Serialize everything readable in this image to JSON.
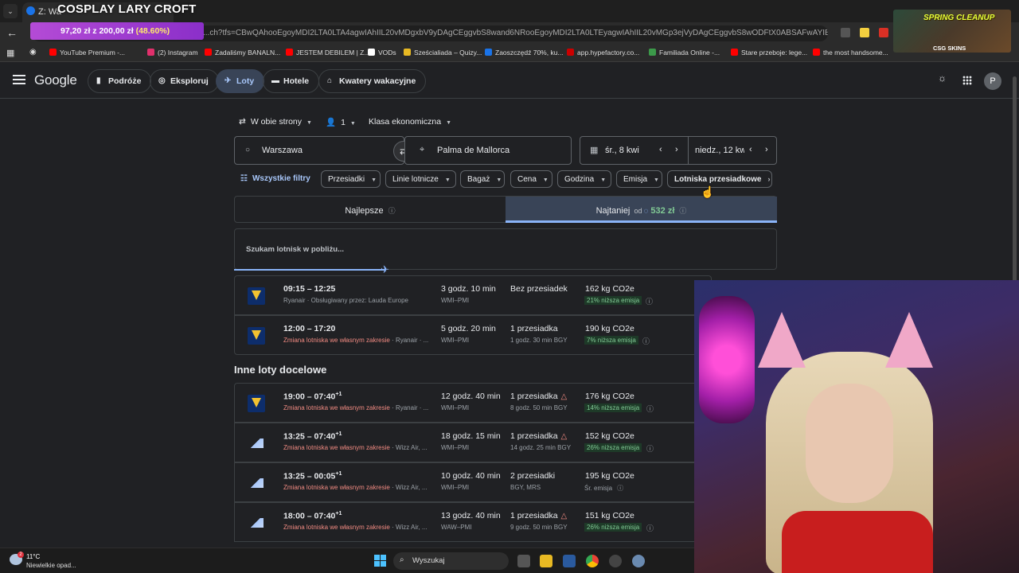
{
  "overlay": {
    "title": "COSPLAY LARY CROFT",
    "promo_amount": "97,20 zł z 200,00 zł",
    "promo_pct": "(48.60%)"
  },
  "browser": {
    "tab_title": "Z: Wa",
    "url": "...ch?tfs=CBwQAhooEgoyMDI2LTA0LTA4agwIAhIIL20vMDgxbV9yDAgCEggvbS8wand6NRooEgoyMDI2LTA0LTEyagwIAhIIL20vMGp3ejVyDAgCEggvbS8wODFtX0ABSAFwAYIBCwj___________",
    "bookmarks": [
      "YouTube Premium -...",
      "(2) Instagram",
      "Zadaliśmy BANALN...",
      "JESTEM DEBILEM | Z...",
      "VODs",
      "Sześcialiada – Quizy...",
      "Zaoszczędź 70%, ku...",
      "app.hypefactory.co...",
      "Familiada Online -...",
      "Stare przeboje: lege...",
      "the most handsome..."
    ],
    "bookmark_colors": [
      "#ff0000",
      "#e1306c",
      "#ff0000",
      "#ff0000",
      "#ffffff",
      "#e8b923",
      "#1a73e8",
      "#cc0000",
      "#3c9a4a",
      "#ff0000",
      "#ff0000"
    ],
    "spring_title": "SPRING CLEANUP",
    "spring_sub": "CSG SKINS"
  },
  "header": {
    "logo": "Google",
    "nav": [
      {
        "label": "Podróże",
        "icon": "suitcase-icon"
      },
      {
        "label": "Eksploruj",
        "icon": "explore-icon"
      },
      {
        "label": "Loty",
        "icon": "plane-icon"
      },
      {
        "label": "Hotele",
        "icon": "bed-icon"
      },
      {
        "label": "Kwatery wakacyjne",
        "icon": "house-icon"
      }
    ],
    "avatar": "P"
  },
  "search": {
    "trip_type": "W obie strony",
    "passengers": "1",
    "cabin": "Klasa ekonomiczna",
    "origin": "Warszawa",
    "destination": "Palma de Mallorca",
    "depart": "śr., 8 kwi",
    "return": "niedz., 12 kwi"
  },
  "filters": {
    "all": "Wszystkie filtry",
    "items": [
      "Przesiadki",
      "Linie lotnicze",
      "Bagaż",
      "Cena",
      "Godzina",
      "Emisja",
      "Lotniska przesiadkowe"
    ]
  },
  "tabs": {
    "best": "Najlepsze",
    "cheapest": "Najtaniej",
    "from": "od",
    "price": "532 zł"
  },
  "status": {
    "searching": "Szukam lotnisk w pobliżu..."
  },
  "section_other": "Inne loty docelowe",
  "flights": [
    {
      "time": "09:15 – 12:25",
      "plus": "",
      "sub_red": "",
      "sub": "Ryanair · Obsługiwany przez: Lauda Europe",
      "duration": "3 godz. 10 min",
      "route": "WMI–PMI",
      "stops": "Bez przesiadek",
      "warn": false,
      "stop_detail": "",
      "co2": "162 kg CO2e",
      "emission": "21% niższa emisja",
      "airline": "ry"
    },
    {
      "time": "12:00 – 17:20",
      "plus": "",
      "sub_red": "Zmiana lotniska we własnym zakresie",
      "sub": " · Ryanair · ...",
      "duration": "5 godz. 20 min",
      "route": "WMI–PMI",
      "stops": "1 przesiadka",
      "warn": false,
      "stop_detail": "1 godz. 30 min BGY",
      "co2": "190 kg CO2e",
      "emission": "7% niższa emisja",
      "airline": "ry"
    },
    {
      "time": "19:00 – 07:40",
      "plus": "+1",
      "sub_red": "Zmiana lotniska we własnym zakresie",
      "sub": " · Ryanair · ...",
      "duration": "12 godz. 40 min",
      "route": "WMI–PMI",
      "stops": "1 przesiadka",
      "warn": true,
      "stop_detail": "8 godz. 50 min BGY",
      "co2": "176 kg CO2e",
      "emission": "14% niższa emisja",
      "airline": "ry"
    },
    {
      "time": "13:25 – 07:40",
      "plus": "+1",
      "sub_red": "Zmiana lotniska we własnym zakresie",
      "sub": " · Wizz Air, ...",
      "duration": "18 godz. 15 min",
      "route": "WMI–PMI",
      "stops": "1 przesiadka",
      "warn": true,
      "stop_detail": "14 godz. 25 min BGY",
      "co2": "152 kg CO2e",
      "emission": "26% niższa emisja",
      "airline": "wz"
    },
    {
      "time": "13:25 – 00:05",
      "plus": "+1",
      "sub_red": "Zmiana lotniska we własnym zakresie",
      "sub": " · Wizz Air, ...",
      "duration": "10 godz. 40 min",
      "route": "WMI–PMI",
      "stops": "2 przesiadki",
      "warn": false,
      "stop_detail": "BGY, MRS",
      "co2": "195 kg CO2e",
      "emission": "Śr. emisja",
      "airline": "wz"
    },
    {
      "time": "18:00 – 07:40",
      "plus": "+1",
      "sub_red": "Zmiana lotniska we własnym zakresie",
      "sub": " · Wizz Air, ...",
      "duration": "13 godz. 40 min",
      "route": "WAW–PMI",
      "stops": "1 przesiadka",
      "warn": true,
      "stop_detail": "9 godz. 50 min BGY",
      "co2": "151 kg CO2e",
      "emission": "26% niższa emisja",
      "airline": "wz"
    }
  ],
  "taskbar": {
    "temp": "11°C",
    "weather": "Niewielkie opad...",
    "search": "Wyszukaj",
    "badge": "2"
  }
}
